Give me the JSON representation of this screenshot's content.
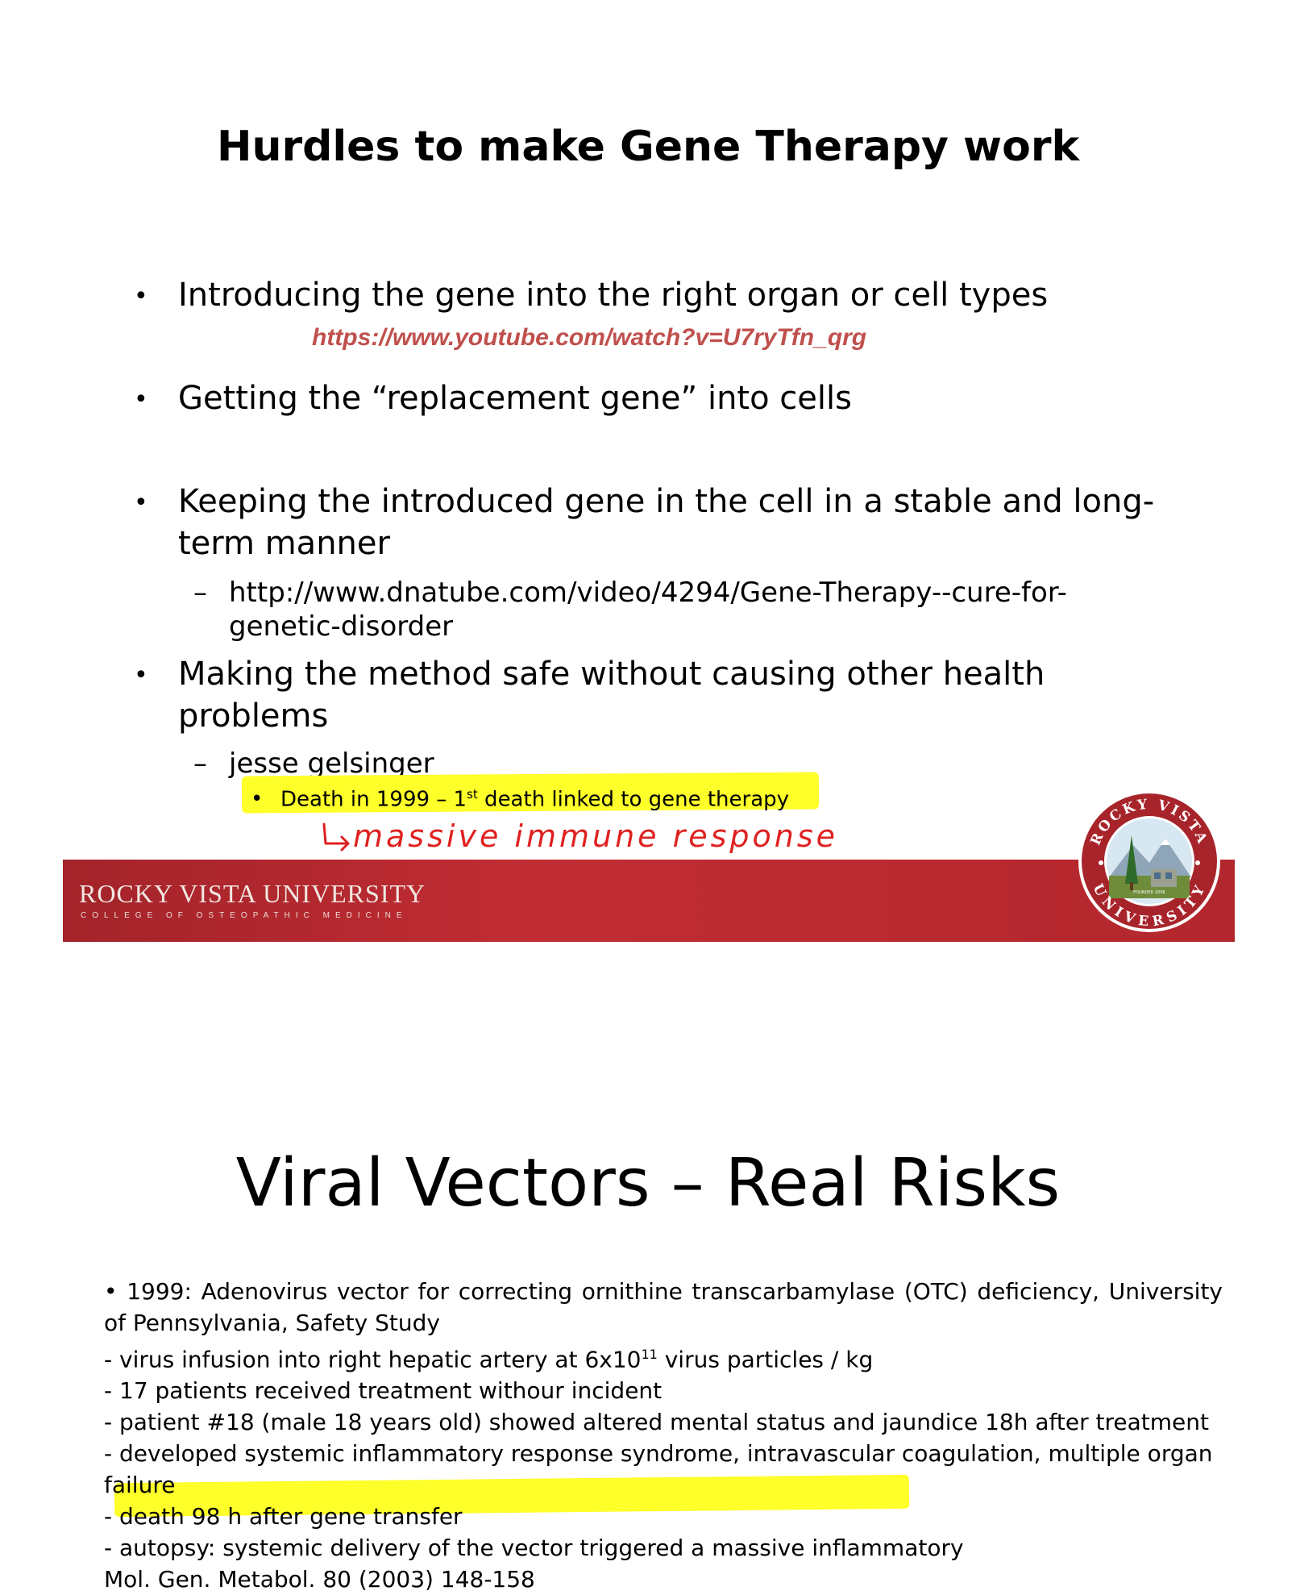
{
  "slide1": {
    "title": "Hurdles to make Gene Therapy work",
    "bullets": [
      "Introducing the gene into the right organ or cell types",
      "Getting the “replacement gene” into cells",
      "Keeping the introduced gene in the cell in a stable and long-",
      "term manner",
      "Making the method safe without causing other health",
      "problems"
    ],
    "bullet_symbol": "•",
    "dash_symbol": "–",
    "youtube_link": "https://www.youtube.com/watch?v=U7ryTfn_qrg",
    "dnatube_link_line1": "http://www.dnatube.com/video/4294/Gene-Therapy--cure-for-",
    "dnatube_link_line2": "genetic-disorder",
    "sub_item": "jesse gelsinger",
    "sub_sub_pre": "Death in 1999 – 1",
    "sub_sub_sup": "st",
    "sub_sub_post": " death linked to gene therapy",
    "handwritten_note": "massive immune response",
    "highlight_color": "#ffff2a",
    "handwriting_color": "#e02020",
    "link_color": "#c0504d"
  },
  "banner": {
    "university": "ROCKY VISTA UNIVERSITY",
    "college": "COLLEGE OF OSTEOPATHIC MEDICINE",
    "seal_top": "ROCKY VISTA",
    "seal_bottom": "UNIVERSITY",
    "seal_founded": "FOUNDED 2006",
    "banner_color": "#b7272e"
  },
  "slide2": {
    "title": "Viral Vectors – Real Risks",
    "intro": "• 1999:  Adenovirus vector for correcting ornithine transcarbamylase (OTC) deficiency, University of Pennsylvania, Safety Study",
    "line1_pre": "- virus infusion into right hepatic artery at 6x10",
    "line1_sup": "11",
    "line1_post": " virus particles / kg",
    "line2": "- 17 patients received treatment withour incident",
    "line3": "- patient #18 (male 18 years old) showed altered mental status and jaundice 18h after treatment",
    "line4": "- developed systemic inflammatory response syndrome, intravascular coagulation, multiple organ failure",
    "line5": "- death 98 h after gene transfer",
    "line6": "- autopsy: systemic delivery of the vector triggered a massive inflammatory",
    "citation": "Mol. Gen. Metabol. 80 (2003) 148-158"
  }
}
